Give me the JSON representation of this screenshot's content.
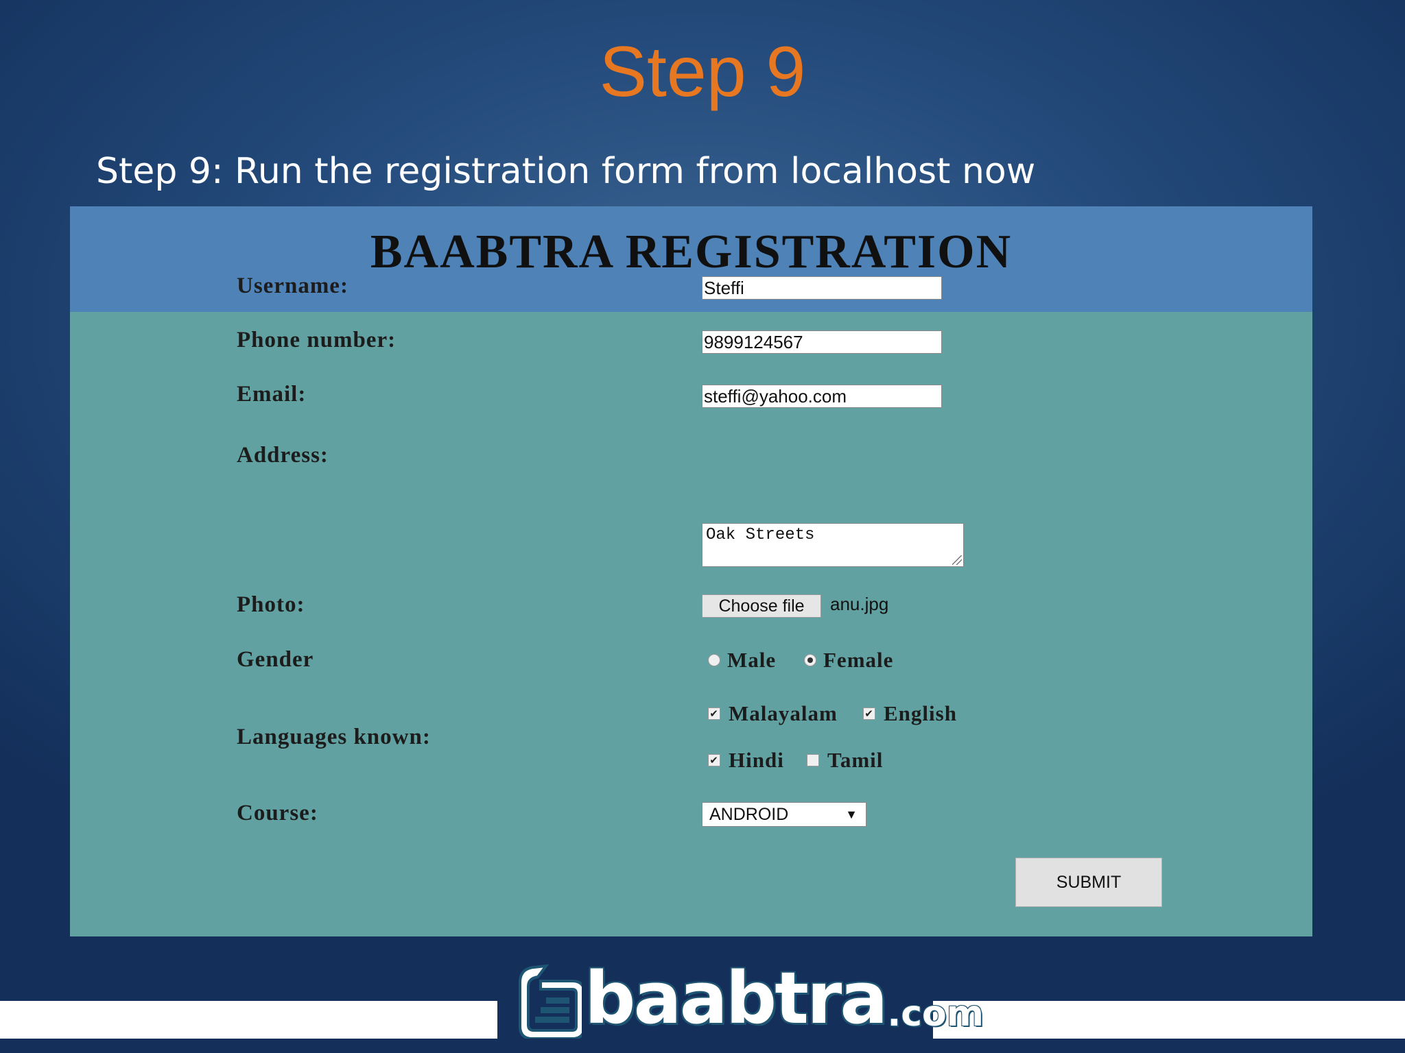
{
  "slide": {
    "title": "Step 9",
    "subtitle": "Step 9: Run the registration form from localhost now"
  },
  "form": {
    "heading": "BAABTRA REGISTRATION",
    "username": {
      "label": "Username:",
      "value": "Steffi"
    },
    "phone": {
      "label": "Phone number:",
      "value": "9899124567"
    },
    "email": {
      "label": "Email:",
      "value": "steffi@yahoo.com"
    },
    "address": {
      "label": "Address:",
      "value": "Oak Streets"
    },
    "photo": {
      "label": "Photo:",
      "button_label": "Choose file",
      "file_name": "anu.jpg"
    },
    "gender": {
      "label": "Gender",
      "options": [
        {
          "label": "Male",
          "selected": false
        },
        {
          "label": "Female",
          "selected": true
        }
      ]
    },
    "languages": {
      "label": "Languages known:",
      "options": [
        {
          "label": "Malayalam",
          "checked": true
        },
        {
          "label": "English",
          "checked": true
        },
        {
          "label": "Hindi",
          "checked": true
        },
        {
          "label": "Tamil",
          "checked": false
        }
      ]
    },
    "course": {
      "label": "Course:",
      "selected": "ANDROID"
    },
    "submit_label": "SUBMIT"
  },
  "footer": {
    "logo_text": "baabtra",
    "logo_suffix": ".com"
  },
  "colors": {
    "title": "#e87722",
    "header_band": "#4f83b8",
    "form_body": "#62a1a1"
  }
}
